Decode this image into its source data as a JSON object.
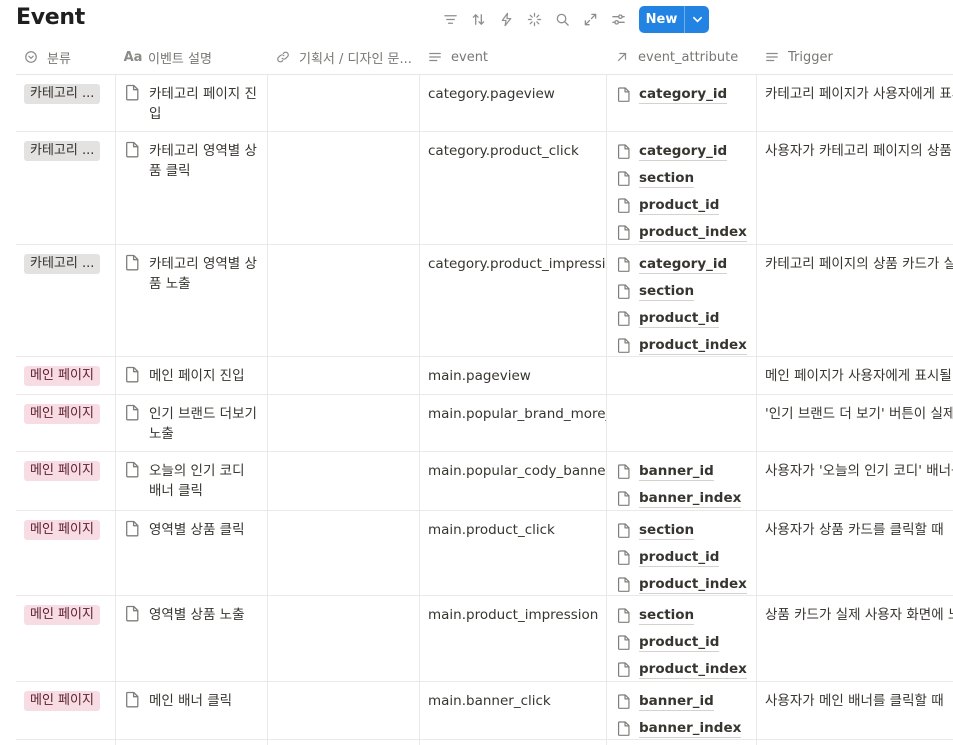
{
  "page": {
    "title": "Event"
  },
  "toolbar": {
    "tools": [
      {
        "name": "filter-icon",
        "icon": "filter"
      },
      {
        "name": "sort-icon",
        "icon": "sort"
      },
      {
        "name": "automation-icon",
        "icon": "lightning"
      },
      {
        "name": "ai-sparkle-icon",
        "icon": "sparkle"
      },
      {
        "name": "search-icon",
        "icon": "search"
      },
      {
        "name": "expand-icon",
        "icon": "expand"
      },
      {
        "name": "settings-icon",
        "icon": "sliders"
      }
    ],
    "new_label": "New"
  },
  "columns": [
    {
      "label": "분류",
      "icon": "select"
    },
    {
      "label": "이벤트 설명",
      "icon": "aa"
    },
    {
      "label": "기획서 / 디자인 문...",
      "icon": "link"
    },
    {
      "label": "event",
      "icon": "lines"
    },
    {
      "label": "event_attribute",
      "icon": "arrow"
    },
    {
      "label": "Trigger",
      "icon": "lines"
    }
  ],
  "rows": [
    {
      "category": "카테고리 ...",
      "category_type": "cat",
      "description": "카테고리 페이지 진입",
      "doc": "",
      "event": "category.pageview",
      "attributes": [
        "category_id"
      ],
      "trigger": "카테고리 페이지가 사용자에게 표시"
    },
    {
      "category": "카테고리 ...",
      "category_type": "cat",
      "description": "카테고리 영역별 상품 클릭",
      "doc": "",
      "event": "category.product_click",
      "attributes": [
        "category_id",
        "section",
        "product_id",
        "product_index"
      ],
      "trigger": "사용자가 카테고리 페이지의 상품 카"
    },
    {
      "category": "카테고리 ...",
      "category_type": "cat",
      "description": "카테고리 영역별 상품 노출",
      "doc": "",
      "event": "category.product_impressio",
      "attributes": [
        "category_id",
        "section",
        "product_id",
        "product_index"
      ],
      "trigger": "카테고리 페이지의 상품 카드가 실제"
    },
    {
      "category": "메인 페이지",
      "category_type": "main",
      "description": "메인 페이지 진입",
      "doc": "",
      "event": "main.pageview",
      "attributes": [],
      "trigger": "메인 페이지가 사용자에게 표시될 때"
    },
    {
      "category": "메인 페이지",
      "category_type": "main",
      "description": "인기 브랜드 더보기 노출",
      "doc": "",
      "event": "main.popular_brand_more_",
      "attributes": [],
      "trigger": "'인기 브랜드 더 보기' 버튼이 실제"
    },
    {
      "category": "메인 페이지",
      "category_type": "main",
      "description": "오늘의 인기 코디 배너 클릭",
      "doc": "",
      "event": "main.popular_cody_banner_",
      "attributes": [
        "banner_id",
        "banner_index"
      ],
      "trigger": "사용자가 '오늘의 인기 코디' 배너를"
    },
    {
      "category": "메인 페이지",
      "category_type": "main",
      "description": "영역별 상품 클릭",
      "doc": "",
      "event": "main.product_click",
      "attributes": [
        "section",
        "product_id",
        "product_index"
      ],
      "trigger": "사용자가 상품 카드를 클릭할 때"
    },
    {
      "category": "메인 페이지",
      "category_type": "main",
      "description": "영역별 상품 노출",
      "doc": "",
      "event": "main.product_impression",
      "attributes": [
        "section",
        "product_id",
        "product_index"
      ],
      "trigger": "상품 카드가 실제 사용자 화면에 노"
    },
    {
      "category": "메인 페이지",
      "category_type": "main",
      "description": "메인 배너 클릭",
      "doc": "",
      "event": "main.banner_click",
      "attributes": [
        "banner_id",
        "banner_index"
      ],
      "trigger": "사용자가 메인 배너를 클릭할 때"
    },
    {
      "category": "",
      "category_type": "main",
      "description": "",
      "doc": "",
      "event": "",
      "attributes": [],
      "trigger": ""
    }
  ]
}
